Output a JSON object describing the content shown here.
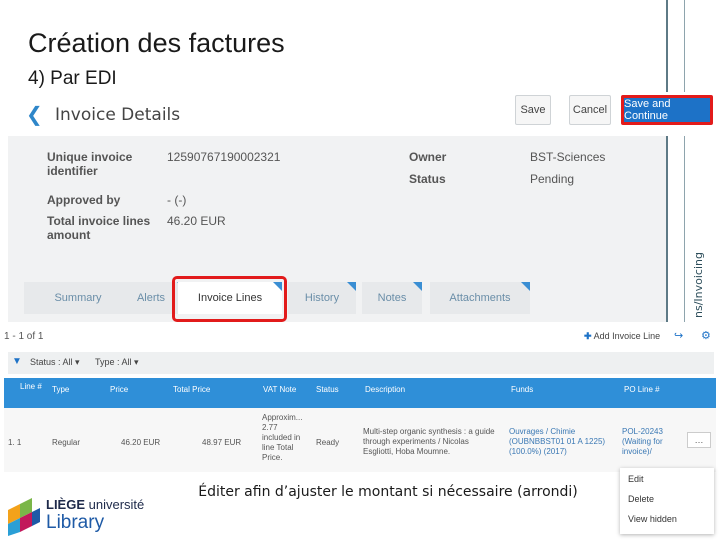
{
  "slide": {
    "title": "Création des factures",
    "subtitle": "4) Par EDI",
    "side_text": "ns/Invoicing",
    "caption": "Éditer afin d’ajuster le montant si nécessaire (arrondi)"
  },
  "header": {
    "title": "Invoice Details",
    "save_label": "Save",
    "cancel_label": "Cancel",
    "continue_label": "Save and Continue"
  },
  "details": {
    "unique_id_label": "Unique invoice identifier",
    "unique_id_value": "12590767190002321",
    "approved_by_label": "Approved by",
    "approved_by_value": "- (-)",
    "total_label": "Total invoice lines amount",
    "total_value": "46.20 EUR",
    "owner_label": "Owner",
    "owner_value": "BST-Sciences",
    "status_label": "Status",
    "status_value": "Pending"
  },
  "tabs": [
    {
      "label": "Summary"
    },
    {
      "label": "Alerts"
    },
    {
      "label": "Invoice Lines"
    },
    {
      "label": "History"
    },
    {
      "label": "Notes"
    },
    {
      "label": "Attachments"
    }
  ],
  "list": {
    "pager": "1 - 1 of 1",
    "add_label": "Add Invoice Line",
    "filter_status": "Status : All",
    "filter_type": "Type : All",
    "columns": [
      "Line #",
      "Type",
      "Price",
      "Total Price",
      "VAT Note",
      "Status",
      "Description",
      "Funds",
      "PO Line #"
    ],
    "row": {
      "line": "1. 1",
      "type": "Regular",
      "price": "46.20 EUR",
      "total_price": "48.97 EUR",
      "vat_note": [
        "Approxim...",
        "2.77",
        "included in",
        "line Total",
        "Price."
      ],
      "status": "Ready",
      "description": [
        "Multi-step organic synthesis : a guide",
        "through experiments / Nicolas",
        "Esgliotti, Hoba Moumne."
      ],
      "funds": [
        "Ouvrages / Chimie",
        "(OUBNBBST01 01 A 1225)",
        "(100.0%) (2017)"
      ],
      "po_line": [
        "POL-20243",
        "(Waiting for",
        "invoice)/"
      ]
    }
  },
  "menu": {
    "edit": "Edit",
    "delete": "Delete",
    "view_hidden": "View hidden"
  },
  "logo": {
    "line1_bold": "LIÈGE",
    "line1_light": "université",
    "line2": "Library"
  },
  "colors": {
    "primary": "#1d72c7",
    "highlight": "#e21b1b",
    "table_header": "#2f8fd8"
  }
}
